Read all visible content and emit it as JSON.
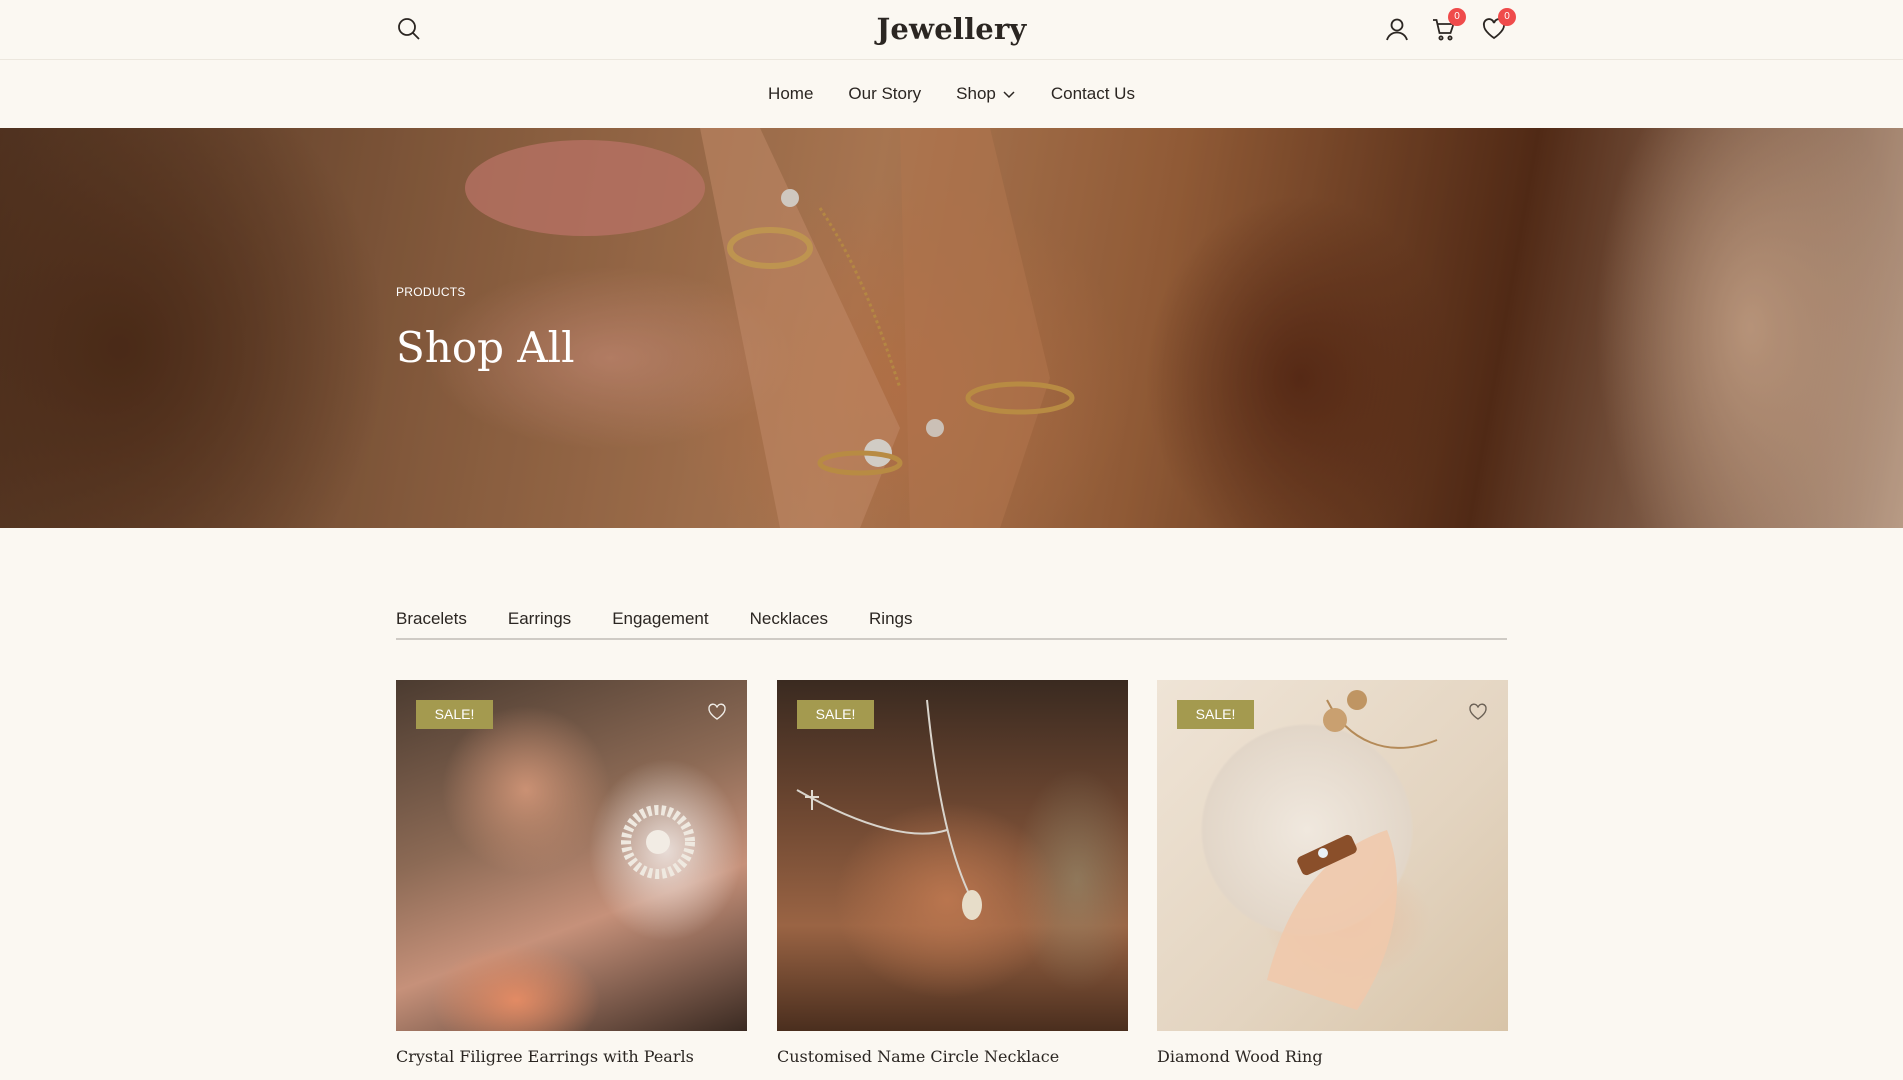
{
  "header": {
    "brand": "Jewellery",
    "cart_count": "0",
    "wishlist_count": "0"
  },
  "nav": {
    "items": [
      {
        "label": "Home"
      },
      {
        "label": "Our Story"
      },
      {
        "label": "Shop"
      },
      {
        "label": "Contact Us"
      }
    ]
  },
  "hero": {
    "eyebrow": "PRODUCTS",
    "title": "Shop All"
  },
  "categories": [
    "Bracelets",
    "Earrings",
    "Engagement",
    "Necklaces",
    "Rings"
  ],
  "products": [
    {
      "badge": "SALE!",
      "name": "Crystal Filigree Earrings with Pearls",
      "wishlist_icon": true
    },
    {
      "badge": "SALE!",
      "name": "Customised Name Circle Necklace",
      "wishlist_icon": false
    },
    {
      "badge": "SALE!",
      "name": "Diamond Wood Ring",
      "wishlist_icon": true
    }
  ],
  "colors": {
    "background": "#fbf8f2",
    "sale_badge": "#a49a4f",
    "counter_badge": "#ef4b4b",
    "text": "#2b2622"
  }
}
